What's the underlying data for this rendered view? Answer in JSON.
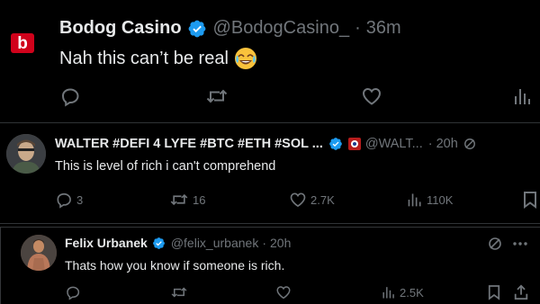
{
  "tweet_main": {
    "avatar_letter": "b",
    "display_name": "Bodog Casino",
    "handle": "@BodogCasino_",
    "separator": "·",
    "time": "36m",
    "text": "Nah this can’t be real",
    "emoji": "😂"
  },
  "reply_1": {
    "display_name": "WALTER #DEFI 4 LYFE #BTC #ETH #SOL ...",
    "handle": "@WALT...",
    "separator": "·",
    "time": "20h",
    "text": "This is level of rich i can't comprehend",
    "replies": "3",
    "reposts": "16",
    "likes": "2.7K",
    "views": "110K"
  },
  "reply_2": {
    "display_name": "Felix Urbanek",
    "handle": "@felix_urbanek",
    "separator": "·",
    "time": "20h",
    "text": "Thats how you know if someone is rich.",
    "views": "2.5K"
  },
  "colors": {
    "background": "#000000",
    "text_primary": "#e7e9ea",
    "text_secondary": "#71767b",
    "verified_blue": "#1d9bf0",
    "divider": "#2f3336",
    "bodog_red": "#d0021b"
  },
  "icons": [
    "reply-icon",
    "repost-icon",
    "like-icon",
    "views-icon",
    "bookmark-icon",
    "share-icon",
    "verified-icon",
    "grok-icon",
    "more-icon"
  ]
}
